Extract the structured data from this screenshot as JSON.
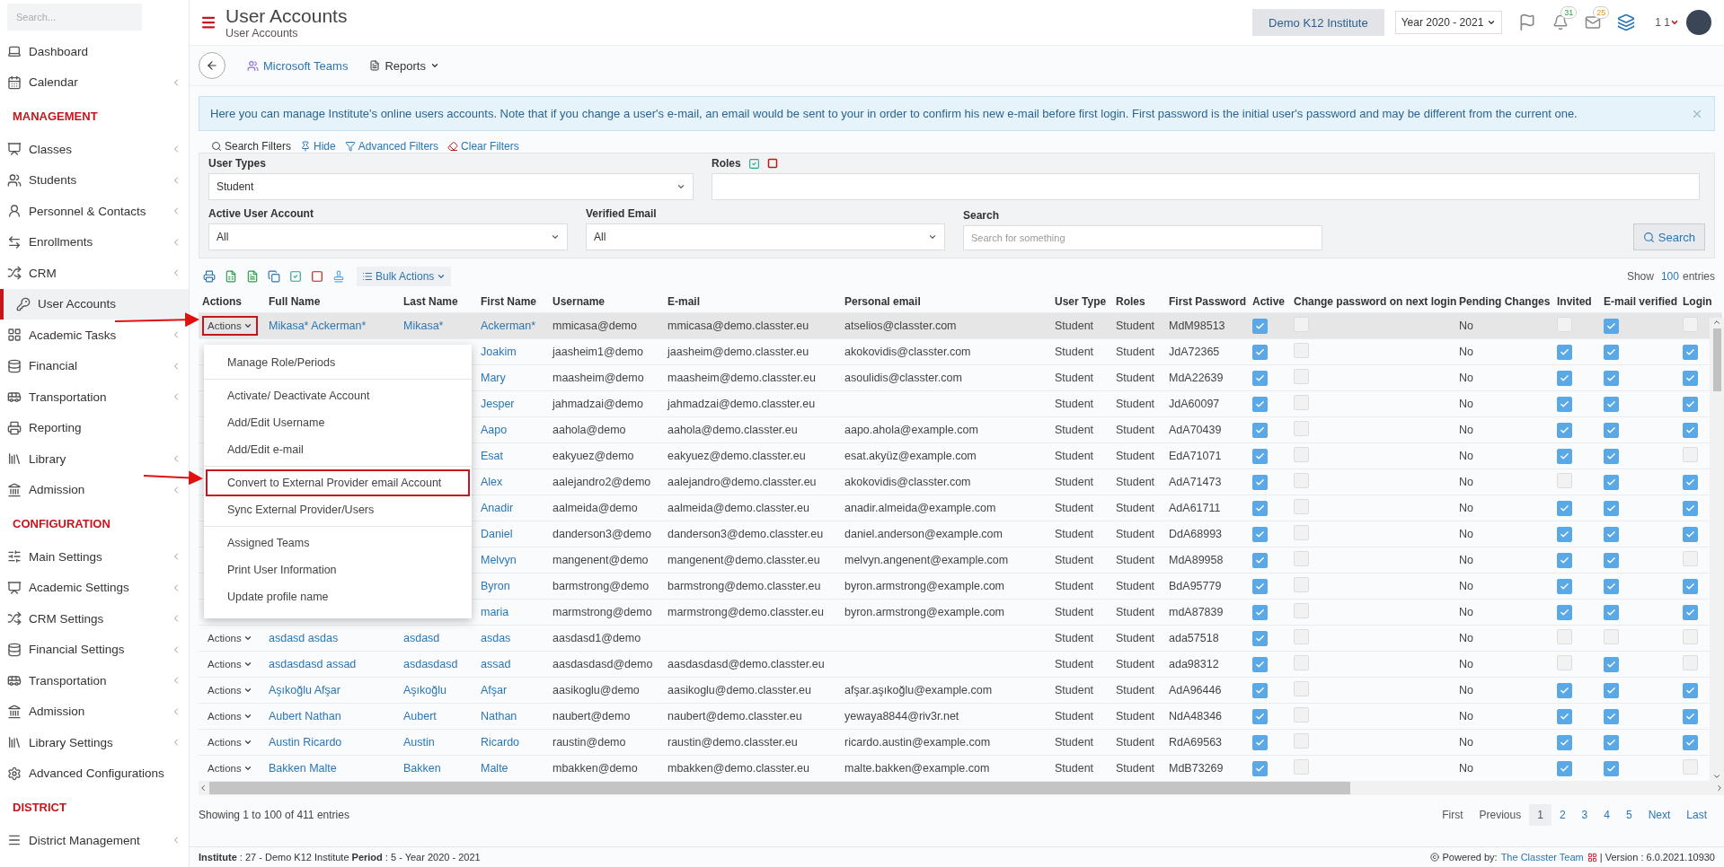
{
  "sidebar": {
    "search": {
      "placeholder": "Search..."
    },
    "items": [
      {
        "kind": "item",
        "label": "Dashboard",
        "submenu": false,
        "selected": false
      },
      {
        "kind": "item",
        "label": "Calendar",
        "submenu": true,
        "selected": false
      },
      {
        "kind": "section",
        "label": "MANAGEMENT"
      },
      {
        "kind": "item",
        "label": "Classes",
        "submenu": true,
        "selected": false
      },
      {
        "kind": "item",
        "label": "Students",
        "submenu": true,
        "selected": false
      },
      {
        "kind": "item",
        "label": "Personnel & Contacts",
        "submenu": true,
        "selected": false
      },
      {
        "kind": "item",
        "label": "Enrollments",
        "submenu": true,
        "selected": false
      },
      {
        "kind": "item",
        "label": "CRM",
        "submenu": true,
        "selected": false
      },
      {
        "kind": "item",
        "label": "User Accounts",
        "submenu": false,
        "selected": true
      },
      {
        "kind": "item",
        "label": "Academic Tasks",
        "submenu": true,
        "selected": false
      },
      {
        "kind": "item",
        "label": "Financial",
        "submenu": true,
        "selected": false
      },
      {
        "kind": "item",
        "label": "Transportation",
        "submenu": true,
        "selected": false
      },
      {
        "kind": "item",
        "label": "Reporting",
        "submenu": false,
        "selected": false
      },
      {
        "kind": "item",
        "label": "Library",
        "submenu": true,
        "selected": false
      },
      {
        "kind": "item",
        "label": "Admission",
        "submenu": true,
        "selected": false
      },
      {
        "kind": "section",
        "label": "CONFIGURATION"
      },
      {
        "kind": "item",
        "label": "Main Settings",
        "submenu": true,
        "selected": false
      },
      {
        "kind": "item",
        "label": "Academic Settings",
        "submenu": true,
        "selected": false
      },
      {
        "kind": "item",
        "label": "CRM Settings",
        "submenu": true,
        "selected": false
      },
      {
        "kind": "item",
        "label": "Financial Settings",
        "submenu": true,
        "selected": false
      },
      {
        "kind": "item",
        "label": "Transportation",
        "submenu": true,
        "selected": false
      },
      {
        "kind": "item",
        "label": "Admission",
        "submenu": true,
        "selected": false
      },
      {
        "kind": "item",
        "label": "Library Settings",
        "submenu": true,
        "selected": false
      },
      {
        "kind": "item",
        "label": "Advanced Configurations",
        "submenu": false,
        "selected": false
      },
      {
        "kind": "section",
        "label": "DISTRICT"
      },
      {
        "kind": "item",
        "label": "District Management",
        "submenu": true,
        "selected": false
      }
    ]
  },
  "header": {
    "title": "User Accounts",
    "subtitle": "User Accounts",
    "institute": "Demo K12 Institute",
    "year": "Year 2020 - 2021",
    "notifications": "31",
    "messages": "25",
    "user": "1 1"
  },
  "toolbar": {
    "links": [
      {
        "label": "Microsoft Teams",
        "dropdown": false
      },
      {
        "label": "Reports",
        "dropdown": true
      }
    ]
  },
  "alert": {
    "text": "Here you can manage Institute's online users accounts. Note that if you change a user's e-mail, an email would be sent to your in order to confirm his new e-mail before first login. First password is the initial user's password and may be different from the current one."
  },
  "filters": {
    "links": [
      "Search Filters",
      "Hide",
      "Advanced Filters",
      "Clear Filters"
    ],
    "rows": [
      [
        {
          "kind": "select",
          "label": "User Types",
          "value": "Student"
        },
        {
          "kind": "roles",
          "label": "Roles"
        }
      ],
      [
        {
          "kind": "select",
          "label": "Active User Account",
          "value": "All"
        },
        {
          "kind": "select",
          "label": "Verified Email",
          "value": "All"
        },
        {
          "kind": "text",
          "label": "Search",
          "placeholder": "Search for something"
        }
      ]
    ],
    "search_button": "Search"
  },
  "table_tools": {
    "bulk_actions": "Bulk Actions",
    "show": "Show",
    "page_size": "100",
    "entries": "entries"
  },
  "table": {
    "columns": [
      {
        "label": "Actions"
      },
      {
        "label": "Full Name"
      },
      {
        "label": "Last Name"
      },
      {
        "label": "First Name"
      },
      {
        "label": "Username"
      },
      {
        "label": "E-mail"
      },
      {
        "label": "Personal email"
      },
      {
        "label": "User Type"
      },
      {
        "label": "Roles"
      },
      {
        "label": "First Password"
      },
      {
        "label": "Active"
      },
      {
        "label": "Change password on next login"
      },
      {
        "label": "Pending Changes"
      },
      {
        "label": "Invited"
      },
      {
        "label": "E-mail verified"
      },
      {
        "label": "Login"
      }
    ],
    "rows": [
      {
        "selected": true,
        "actions": "Actions",
        "action_highlighted": true,
        "full_name": "Mikasa* Ackerman*",
        "last_name": "Mikasa*",
        "first_name": "Ackerman*",
        "username": "mmicasa@demo",
        "email": "mmicasa@demo.classter.eu",
        "personal_email": "atselios@classter.com",
        "user_type": "Student",
        "role": "Student",
        "first_password": "MdM98513",
        "active": true,
        "change_password": false,
        "pending": "No",
        "invited": false,
        "email_verified": true,
        "login": false
      },
      {
        "selected": false,
        "first_name": "Joakim",
        "username": "jaasheim1@demo",
        "email": "jaasheim@demo.classter.eu",
        "personal_email": "akokovidis@classter.com",
        "user_type": "Student",
        "role": "Student",
        "first_password": "JdA72365",
        "active": true,
        "change_password": false,
        "pending": "No",
        "invited": true,
        "email_verified": true,
        "login": true
      },
      {
        "selected": false,
        "first_name": "Mary",
        "username": "maasheim@demo",
        "email": "maasheim@demo.classter.eu",
        "personal_email": "asoulidis@classter.com",
        "user_type": "Student",
        "role": "Student",
        "first_password": "MdA22639",
        "active": true,
        "change_password": false,
        "pending": "No",
        "invited": true,
        "email_verified": true,
        "login": true
      },
      {
        "selected": false,
        "first_name": "Jesper",
        "username": "jahmadzai@demo",
        "email": "jahmadzai@demo.classter.eu",
        "user_type": "Student",
        "role": "Student",
        "first_password": "JdA60097",
        "active": true,
        "change_password": false,
        "pending": "No",
        "invited": true,
        "email_verified": true,
        "login": true
      },
      {
        "selected": false,
        "first_name": "Aapo",
        "username": "aahola@demo",
        "email": "aahola@demo.classter.eu",
        "personal_email": "aapo.ahola@example.com",
        "user_type": "Student",
        "role": "Student",
        "first_password": "AdA70439",
        "active": true,
        "change_password": false,
        "pending": "No",
        "invited": true,
        "email_verified": true,
        "login": true
      },
      {
        "selected": false,
        "first_name": "Esat",
        "username": "eakyuez@demo",
        "email": "eakyuez@demo.classter.eu",
        "personal_email": "esat.akyüz@example.com",
        "user_type": "Student",
        "role": "Student",
        "first_password": "EdA71071",
        "active": true,
        "change_password": false,
        "pending": "No",
        "invited": true,
        "email_verified": true,
        "login": false
      },
      {
        "selected": false,
        "first_name": "Alex",
        "username": "aalejandro2@demo",
        "email": "aalejandro@demo.classter.eu",
        "personal_email": "akokovidis@classter.com",
        "user_type": "Student",
        "role": "Student",
        "first_password": "AdA71473",
        "active": true,
        "change_password": false,
        "pending": "No",
        "invited": false,
        "email_verified": true,
        "login": true
      },
      {
        "selected": false,
        "first_name": "Anadir",
        "username": "aalmeida@demo",
        "email": "aalmeida@demo.classter.eu",
        "personal_email": "anadir.almeida@example.com",
        "user_type": "Student",
        "role": "Student",
        "first_password": "AdA61711",
        "active": true,
        "change_password": false,
        "pending": "No",
        "invited": true,
        "email_verified": true,
        "login": true
      },
      {
        "selected": false,
        "first_name": "Daniel",
        "username": "danderson3@demo",
        "email": "danderson3@demo.classter.eu",
        "personal_email": "daniel.anderson@example.com",
        "user_type": "Student",
        "role": "Student",
        "first_password": "DdA68993",
        "active": true,
        "change_password": false,
        "pending": "No",
        "invited": true,
        "email_verified": true,
        "login": true
      },
      {
        "selected": false,
        "first_name": "Melvyn",
        "username": "mangenent@demo",
        "email": "mangenent@demo.classter.eu",
        "personal_email": "melvyn.angenent@example.com",
        "user_type": "Student",
        "role": "Student",
        "first_password": "MdA89958",
        "active": true,
        "change_password": false,
        "pending": "No",
        "invited": true,
        "email_verified": true,
        "login": false
      },
      {
        "selected": false,
        "first_name": "Byron",
        "username": "barmstrong@demo",
        "email": "barmstrong@demo.classter.eu",
        "personal_email": "byron.armstrong@example.com",
        "user_type": "Student",
        "role": "Student",
        "first_password": "BdA95779",
        "active": true,
        "change_password": false,
        "pending": "No",
        "invited": true,
        "email_verified": true,
        "login": true
      },
      {
        "selected": false,
        "first_name": "maria",
        "username": "marmstrong@demo",
        "email": "marmstrong@demo.classter.eu",
        "personal_email": "byron.armstrong@example.com",
        "user_type": "Student",
        "role": "Student",
        "first_password": "mdA87839",
        "active": true,
        "change_password": false,
        "pending": "No",
        "invited": true,
        "email_verified": true,
        "login": true
      },
      {
        "selected": false,
        "actions": "Actions",
        "action_highlighted": false,
        "full_name": "asdasd asdas",
        "last_name": "asdasd",
        "first_name": "asdas",
        "username": "aasdasd1@demo",
        "user_type": "Student",
        "role": "Student",
        "first_password": "ada57518",
        "active": true,
        "change_password": false,
        "pending": "No",
        "invited": false,
        "email_verified": false,
        "login": false
      },
      {
        "selected": false,
        "actions": "Actions",
        "action_highlighted": false,
        "full_name": "asdasdasd assad",
        "last_name": "asdasdasd",
        "first_name": "assad",
        "username": "aasdasdasd@demo",
        "email": "aasdasdasd@demo.classter.eu",
        "user_type": "Student",
        "role": "Student",
        "first_password": "ada98312",
        "active": true,
        "change_password": false,
        "pending": "No",
        "invited": false,
        "email_verified": true,
        "login": false
      },
      {
        "selected": false,
        "actions": "Actions",
        "action_highlighted": false,
        "full_name": "Aşıkoğlu Afşar",
        "last_name": "Aşıkoğlu",
        "first_name": "Afşar",
        "username": "aasikoglu@demo",
        "email": "aasikoglu@demo.classter.eu",
        "personal_email": "afşar.aşıkoğlu@example.com",
        "user_type": "Student",
        "role": "Student",
        "first_password": "AdA96446",
        "active": true,
        "change_password": false,
        "pending": "No",
        "invited": true,
        "email_verified": true,
        "login": true
      },
      {
        "selected": false,
        "actions": "Actions",
        "action_highlighted": false,
        "full_name": "Aubert Nathan",
        "last_name": "Aubert",
        "first_name": "Nathan",
        "username": "naubert@demo",
        "email": "naubert@demo.classter.eu",
        "personal_email": "yewaya8844@riv3r.net",
        "user_type": "Student",
        "role": "Student",
        "first_password": "NdA48346",
        "active": true,
        "change_password": false,
        "pending": "No",
        "invited": true,
        "email_verified": true,
        "login": true
      },
      {
        "selected": false,
        "actions": "Actions",
        "action_highlighted": false,
        "full_name": "Austin Ricardo",
        "last_name": "Austin",
        "first_name": "Ricardo",
        "username": "raustin@demo",
        "email": "raustin@demo.classter.eu",
        "personal_email": "ricardo.austin@example.com",
        "user_type": "Student",
        "role": "Student",
        "first_password": "RdA69563",
        "active": true,
        "change_password": false,
        "pending": "No",
        "invited": true,
        "email_verified": true,
        "login": true
      },
      {
        "selected": false,
        "actions": "Actions",
        "action_highlighted": false,
        "full_name": "Bakken Malte",
        "last_name": "Bakken",
        "first_name": "Malte",
        "username": "mbakken@demo",
        "email": "mbakken@demo.classter.eu",
        "personal_email": "malte.bakken@example.com",
        "user_type": "Student",
        "role": "Student",
        "first_password": "MdB73269",
        "active": true,
        "change_password": false,
        "pending": "No",
        "invited": true,
        "email_verified": true,
        "login": false
      }
    ]
  },
  "menu": {
    "groups": [
      {
        "items": [
          {
            "label": "Manage Role/Periods",
            "highlighted": false
          }
        ]
      },
      {
        "items": [
          {
            "label": "Activate/ Deactivate Account",
            "highlighted": false
          },
          {
            "label": "Add/Edit Username",
            "highlighted": false
          },
          {
            "label": "Add/Edit e-mail",
            "highlighted": false
          }
        ]
      },
      {
        "items": [
          {
            "label": "Convert to External Provider email Account",
            "highlighted": true
          },
          {
            "label": "Sync External Provider/Users",
            "highlighted": false
          }
        ]
      },
      {
        "items": [
          {
            "label": "Assigned Teams",
            "highlighted": false
          },
          {
            "label": "Print User Information",
            "highlighted": false
          },
          {
            "label": "Update profile name",
            "highlighted": false
          }
        ]
      }
    ]
  },
  "pagination": {
    "info": "Showing 1 to 100 of 411 entries",
    "pages": [
      {
        "label": "First",
        "selected": false
      },
      {
        "label": "Previous",
        "selected": false
      },
      {
        "label": "1",
        "selected": true
      },
      {
        "label": "2",
        "selected": false
      },
      {
        "label": "3",
        "selected": false
      },
      {
        "label": "4",
        "selected": false
      },
      {
        "label": "5",
        "selected": false
      },
      {
        "label": "Next",
        "selected": false
      },
      {
        "label": "Last",
        "selected": false
      }
    ]
  },
  "footer": {
    "info": "**Institute** : 27 - Demo K12 Institute **Period** : 5 - Year 2020 - 2021",
    "powered": "Powered by:",
    "team": "The Classter Team",
    "version": "| Version : 6.0.2021.10930"
  }
}
